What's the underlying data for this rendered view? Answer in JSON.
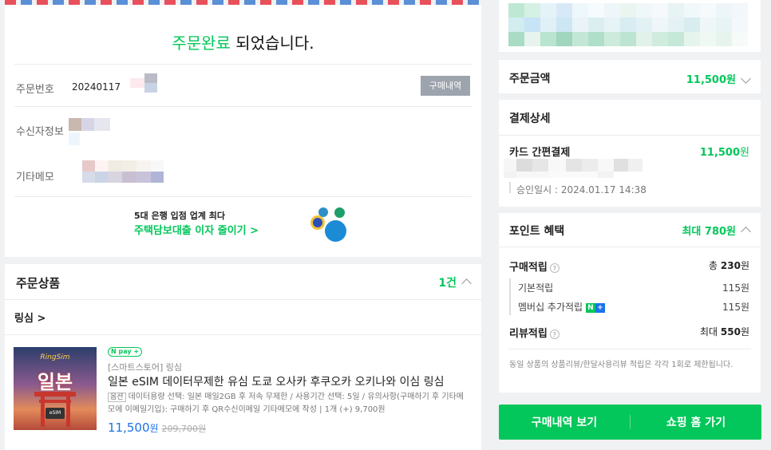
{
  "order_complete": {
    "title_green": "주문완료",
    "title_rest": " 되었습니다.",
    "order_number_label": "주문번호",
    "order_number_value": "20240117",
    "purchase_history_button": "구매내역",
    "recipient_label": "수신자정보",
    "memo_label": "기타메모",
    "ad_line1": "5대 은행 입점 업계 최다",
    "ad_line2": "주택담보대출 이자 줄이기 >"
  },
  "ordered_products": {
    "title": "주문상품",
    "count": "1건",
    "store_link": "링심 >",
    "product": {
      "thumb_brand": "RingSim",
      "thumb_title": "일본",
      "thumb_chip": "eSIM",
      "npay_label": "pay",
      "store_name": "[스마트스토어] 링심",
      "name": "일본 eSIM 데이터무제한 유심 도쿄 오사카 후쿠오카 오키나와 이심 링심",
      "option_tag": "옵션",
      "option_text": "데이터용량 선택: 일본 매일2GB 후 저속 무제한 / 사용기간 선택: 5일 / 유의사항(구매하기 후 기타메모에 이메일기입): 구매하기 후 QR수신이메일 기타메모에 작성 | 1개 (+) 9,700원",
      "price": "11,500",
      "price_unit": "원",
      "original_price": "209,700원"
    }
  },
  "summary": {
    "order_amount_label": "주문금액",
    "order_amount_value": "11,500원"
  },
  "payment_detail": {
    "title": "결제상세",
    "method": "카드 간편결제",
    "amount": "11,500",
    "amount_unit": "원",
    "approval": "승인일시 : 2024.01.17 14:38"
  },
  "points": {
    "title": "포인트 혜택",
    "max_label": "최대 780원",
    "purchase_label": "구매적립",
    "purchase_total_prefix": "총 ",
    "purchase_total": "230",
    "purchase_total_unit": "원",
    "basic_label": "기본적립",
    "basic_value": "115원",
    "membership_label": "멤버십 추가적립",
    "membership_badge_n": "N",
    "membership_badge_plus": "+",
    "membership_value": "115원",
    "review_label": "리뷰적립",
    "review_prefix": "최대 ",
    "review_value": "550",
    "review_unit": "원",
    "info_icon": "?",
    "notice": "동일 상품의 상품리뷰/한달사용리뷰 적립은 각각 1회로 제한됩니다."
  },
  "actions": {
    "history_button": "구매내역 보기",
    "shop_home_button": "쇼핑 홈 가기"
  },
  "colors": {
    "naver_green": "#03c75a",
    "price_blue": "#1a73e8",
    "gray_button": "#9ea4ad"
  }
}
